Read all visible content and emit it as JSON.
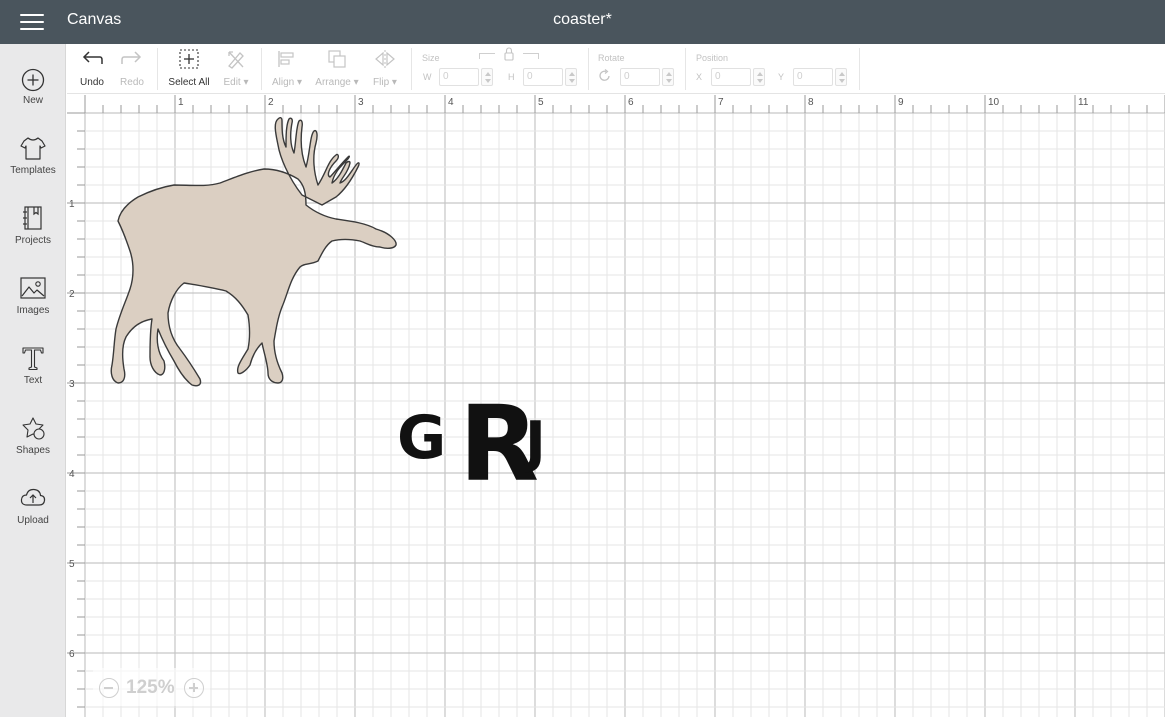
{
  "header": {
    "app_title": "Canvas",
    "doc_title": "coaster*"
  },
  "sidebar": {
    "items": [
      {
        "label": "New",
        "icon": "plus-circle-icon"
      },
      {
        "label": "Templates",
        "icon": "tshirt-icon"
      },
      {
        "label": "Projects",
        "icon": "notebook-icon"
      },
      {
        "label": "Images",
        "icon": "image-icon"
      },
      {
        "label": "Text",
        "icon": "text-icon"
      },
      {
        "label": "Shapes",
        "icon": "shapes-icon"
      },
      {
        "label": "Upload",
        "icon": "cloud-upload-icon"
      }
    ]
  },
  "toolbar": {
    "undo": "Undo",
    "redo": "Redo",
    "select_all": "Select All",
    "edit": "Edit",
    "align": "Align",
    "arrange": "Arrange",
    "flip": "Flip",
    "size_label": "Size",
    "w_label": "W",
    "w_value": "0",
    "h_label": "H",
    "h_value": "0",
    "rotate_label": "Rotate",
    "rotate_value": "0",
    "position_label": "Position",
    "x_label": "X",
    "x_value": "0",
    "y_label": "Y",
    "y_value": "0"
  },
  "rulers": {
    "top": [
      "1",
      "2",
      "3",
      "4",
      "5",
      "6",
      "7",
      "8",
      "9",
      "10",
      "11"
    ],
    "left": [
      "1",
      "2",
      "3",
      "4",
      "5",
      "6"
    ]
  },
  "canvas": {
    "monogram": {
      "left": "G",
      "center": "R",
      "right": "J"
    },
    "moose_color": "#dbcfc2"
  },
  "zoom": {
    "value": "125%"
  },
  "colors": {
    "topbar": "#4a555d",
    "sidebar": "#e9e9ea",
    "grid_major": "#c6c6c6",
    "grid_minor": "#e5e5e5"
  }
}
